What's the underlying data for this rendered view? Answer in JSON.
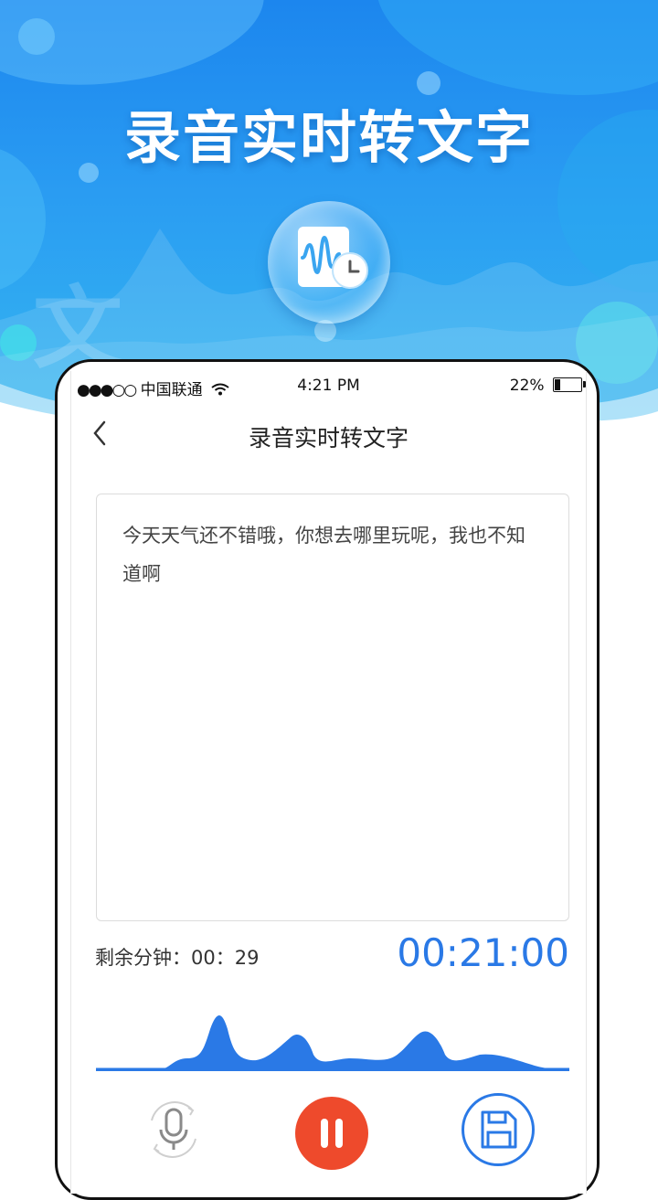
{
  "hero": {
    "title": "录音实时转文字",
    "bg_char": "文"
  },
  "status_bar": {
    "carrier": "中国联通",
    "time": "4:21 PM",
    "battery": "22%"
  },
  "nav": {
    "title": "录音实时转文字"
  },
  "transcript": {
    "text": "今天天气还不错哦，你想去哪里玩呢，我也不知道啊"
  },
  "timer": {
    "remaining_label": "剩余分钟：",
    "remaining_value": "00：29",
    "elapsed": "00:21:00"
  },
  "colors": {
    "accent": "#2a79e6",
    "record": "#ee4a2c",
    "hero_top": "#1c86ee"
  },
  "controls": {
    "mic_icon": "microphone-icon",
    "pause_icon": "pause-icon",
    "save_icon": "floppy-disk-icon"
  }
}
